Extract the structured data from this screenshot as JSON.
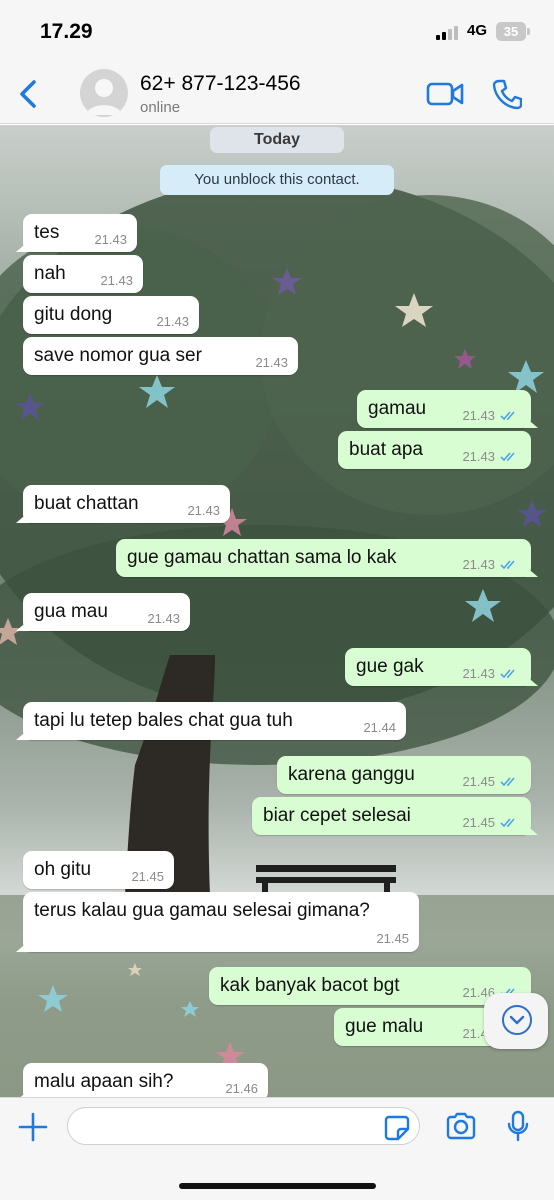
{
  "status_bar": {
    "time": "17.29",
    "network": "4G",
    "battery": "35"
  },
  "header": {
    "contact_name": "62+ 877-123-456",
    "contact_status": "online"
  },
  "chat": {
    "date_label": "Today",
    "system_message": "You unblock this contact.",
    "messages": [
      {
        "dir": "in",
        "text": "tes",
        "time": "21.43"
      },
      {
        "dir": "in",
        "text": "nah",
        "time": "21.43"
      },
      {
        "dir": "in",
        "text": "gitu dong",
        "time": "21.43"
      },
      {
        "dir": "in",
        "text": "save nomor gua ser",
        "time": "21.43"
      },
      {
        "dir": "out",
        "text": "gamau",
        "time": "21.43"
      },
      {
        "dir": "out",
        "text": "buat apa",
        "time": "21.43"
      },
      {
        "dir": "in",
        "text": "buat chattan",
        "time": "21.43"
      },
      {
        "dir": "out",
        "text": "gue gamau chattan sama lo kak",
        "time": "21.43"
      },
      {
        "dir": "in",
        "text": "gua mau",
        "time": "21.43"
      },
      {
        "dir": "out",
        "text": "gue gak",
        "time": "21.43"
      },
      {
        "dir": "in",
        "text": "tapi lu tetep bales chat gua tuh",
        "time": "21.44"
      },
      {
        "dir": "out",
        "text": "karena ganggu",
        "time": "21.45"
      },
      {
        "dir": "out",
        "text": "biar cepet selesai",
        "time": "21.45"
      },
      {
        "dir": "in",
        "text": "oh gitu",
        "time": "21.45"
      },
      {
        "dir": "in",
        "text": "terus kalau gua gamau selesai gimana?",
        "time": "21.45"
      },
      {
        "dir": "out",
        "text": "kak banyak bacot bgt",
        "time": "21.46"
      },
      {
        "dir": "out",
        "text": "gue malu",
        "time": "21.46"
      },
      {
        "dir": "in",
        "text": "malu apaan sih?",
        "time": "21.46"
      }
    ]
  },
  "input": {
    "placeholder": ""
  },
  "colors": {
    "accent": "#1f7ae0",
    "incoming": "#ffffff",
    "outgoing": "#d9fdd3",
    "read_ticks": "#4fa3e8"
  },
  "icons": [
    "back-chevron-icon",
    "avatar-placeholder-icon",
    "video-call-icon",
    "phone-icon",
    "scroll-down-icon",
    "plus-icon",
    "sticker-icon",
    "camera-icon",
    "microphone-icon",
    "double-check-icon"
  ]
}
